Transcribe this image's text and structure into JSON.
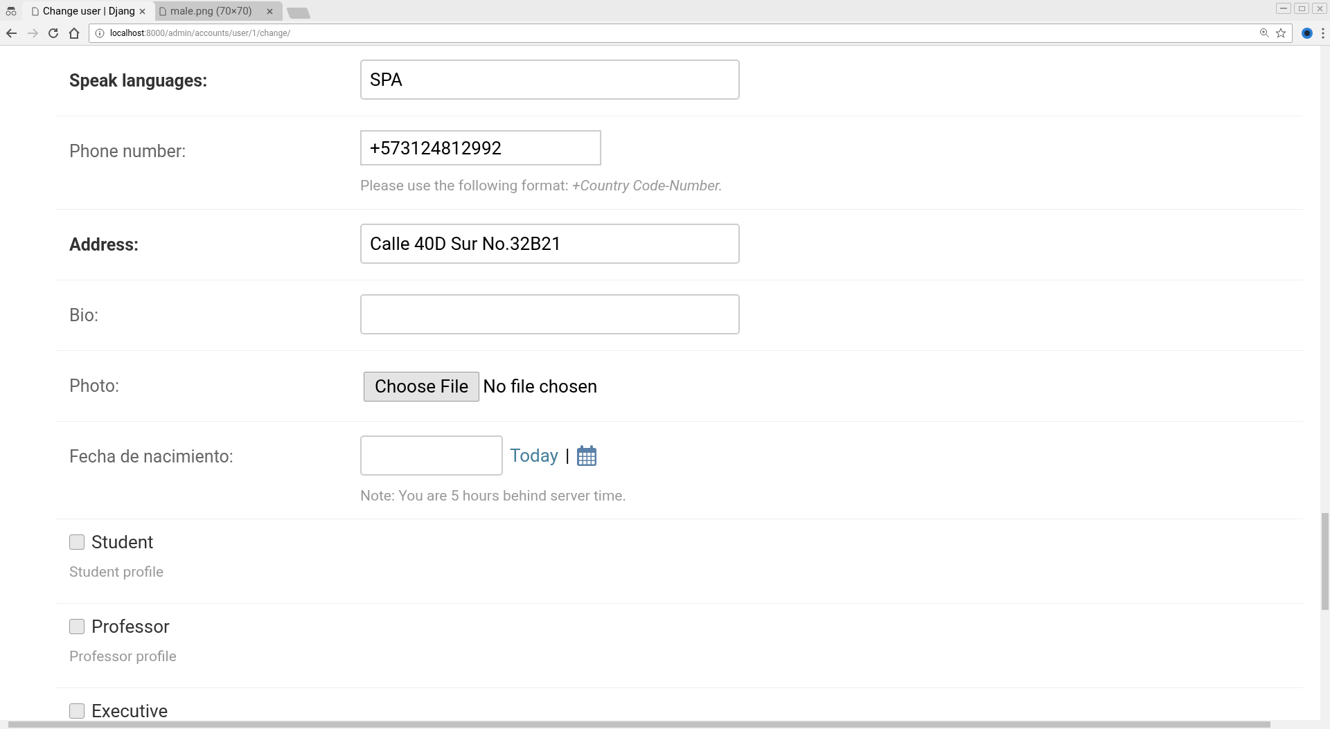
{
  "browser": {
    "tabs": [
      {
        "title": "Change user | Djang",
        "selected": true
      },
      {
        "title": "male.png (70×70)",
        "selected": false
      }
    ],
    "url": {
      "host": "localhost",
      "path": ":8000/admin/accounts/user/1/change/"
    }
  },
  "form": {
    "rows": [
      {
        "kind": "text",
        "label": "Speak languages:",
        "required": true,
        "value": "SPA",
        "wide": true
      },
      {
        "kind": "text",
        "label": "Phone number:",
        "required": false,
        "value": "+573124812992",
        "wide": false,
        "help": "Please use the following format: *+Country Code-Number.*"
      },
      {
        "kind": "text",
        "label": "Address:",
        "required": true,
        "value": "Calle 40D Sur No.32B21",
        "wide": true
      },
      {
        "kind": "text",
        "label": "Bio:",
        "required": false,
        "value": "",
        "wide": true
      },
      {
        "kind": "file",
        "label": "Photo:",
        "required": false,
        "button": "Choose File",
        "status": "No file chosen"
      },
      {
        "kind": "date",
        "label": "Fecha de nacimiento:",
        "required": false,
        "today": "Today",
        "separator": "|",
        "help": "Note: You are 5 hours behind server time."
      },
      {
        "kind": "checkbox",
        "label": "Student",
        "checked": false,
        "help": "Student profile"
      },
      {
        "kind": "checkbox",
        "label": "Professor",
        "checked": false,
        "help": "Professor profile"
      },
      {
        "kind": "checkbox",
        "label": "Executive",
        "checked": false
      }
    ]
  }
}
